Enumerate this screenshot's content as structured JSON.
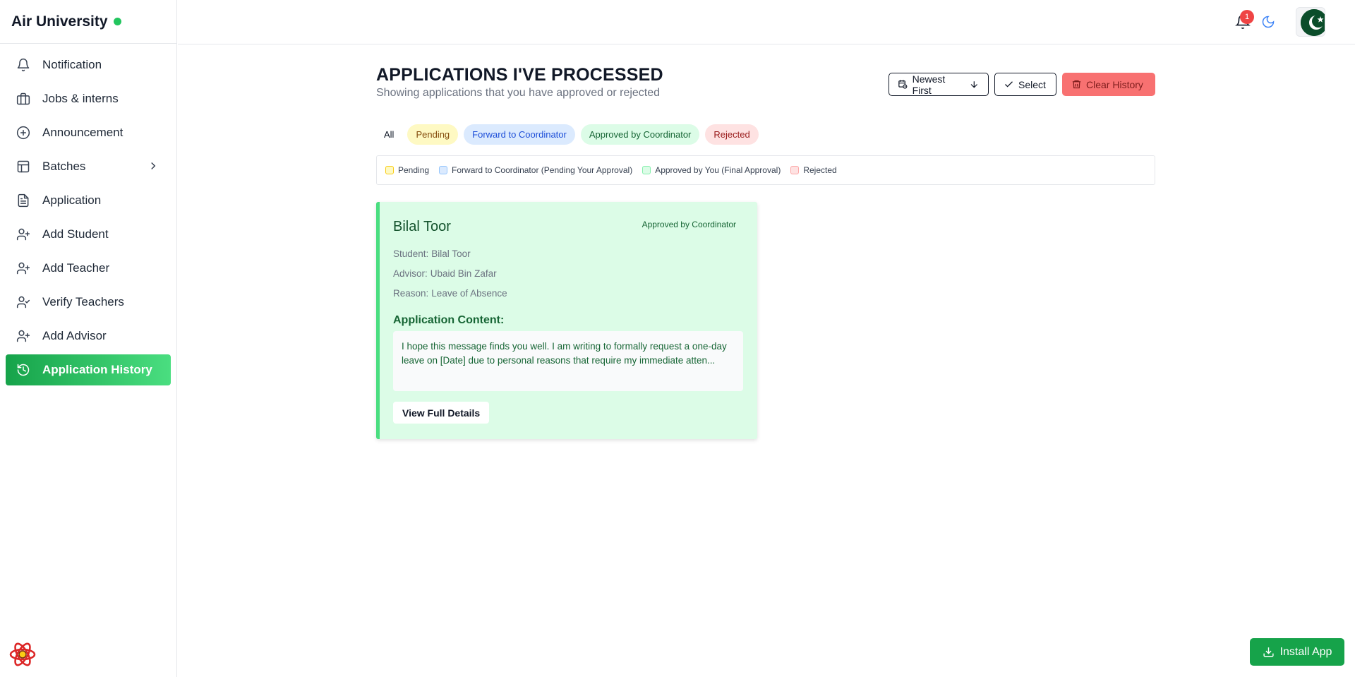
{
  "app": {
    "title": "Air University",
    "status_color": "#22c55e"
  },
  "sidebar": {
    "items": [
      {
        "label": "Notification",
        "icon": "bell-icon"
      },
      {
        "label": "Jobs & interns",
        "icon": "briefcase-icon"
      },
      {
        "label": "Announcement",
        "icon": "plus-circle-icon"
      },
      {
        "label": "Batches",
        "icon": "layout-icon"
      },
      {
        "label": "Application",
        "icon": "file-text-icon"
      },
      {
        "label": "Add Student",
        "icon": "user-plus-icon"
      },
      {
        "label": "Add Teacher",
        "icon": "user-plus-icon"
      },
      {
        "label": "Verify Teachers",
        "icon": "user-check-icon"
      },
      {
        "label": "Add Advisor",
        "icon": "user-plus-icon"
      },
      {
        "label": "Application History",
        "icon": "history-icon",
        "active": true
      }
    ]
  },
  "topbar": {
    "notification_count": "1"
  },
  "main": {
    "title": "APPLICATIONS I'VE PROCESSED",
    "subtitle": "Showing applications that you have approved or rejected",
    "sort_label": "Newest First",
    "select_label": "Select",
    "clear_label": "Clear History",
    "tabs": [
      "All",
      "Pending",
      "Forward to Coordinator",
      "Approved by Coordinator",
      "Rejected"
    ],
    "legend": [
      "Pending",
      "Forward to Coordinator (Pending Your Approval)",
      "Approved by You (Final Approval)",
      "Rejected"
    ],
    "card": {
      "name": "Bilal Toor",
      "status": "Approved by Coordinator",
      "student_label": "Student:",
      "student": "Bilal Toor",
      "advisor_label": "Advisor:",
      "advisor": "Ubaid Bin Zafar",
      "reason_label": "Reason:",
      "reason": "Leave of Absence",
      "content_title": "Application Content:",
      "content": "I hope this message finds you well. I am writing to formally request a one-day leave on [Date] due to personal reasons that require my immediate atten...",
      "details_button": "View Full Details"
    }
  },
  "install_label": "Install App",
  "colors": {
    "accent": "#16a34a",
    "danger": "#f87171",
    "approved_bg": "#dcfce7"
  }
}
